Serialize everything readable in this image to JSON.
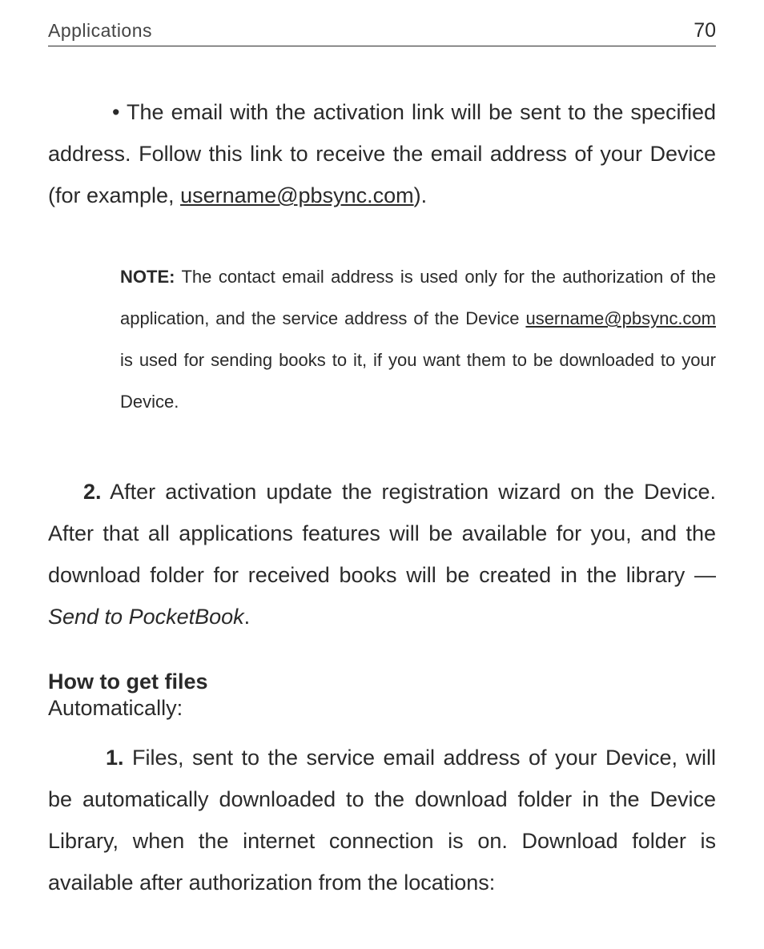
{
  "header": {
    "section": "Applications",
    "page_number": "70"
  },
  "bullet": {
    "marker": "•",
    "lead": "  The email with the activation link will be sent to the specified address. Follow this link to receive the email address of your Device (for example, ",
    "email": "username@pbsync.com",
    "tail": ")."
  },
  "note": {
    "label": "NOTE:",
    "part1": " The contact email address is used only for the authorization of the application, and the service address of the Device ",
    "email": "username@pbsync.com",
    "part2": " is used for sending books to it, if you want them to be downloaded to your Device."
  },
  "step2": {
    "num": "2.",
    "text": "  After activation update the registration wizard on the Device. After that all applications features will be available for you, and the download folder for received books will be created in the library — ",
    "italic": "Send to PocketBook",
    "tail": "."
  },
  "howto": {
    "heading": "How to get files",
    "mode": "Automatically:"
  },
  "step1b": {
    "num": "1.",
    "text": "  Files, sent to the service email address of your Device, will be automatically downloaded to the download folder in the Device Library, when the internet connection is on. Download folder is available after authorization from the locations:"
  }
}
